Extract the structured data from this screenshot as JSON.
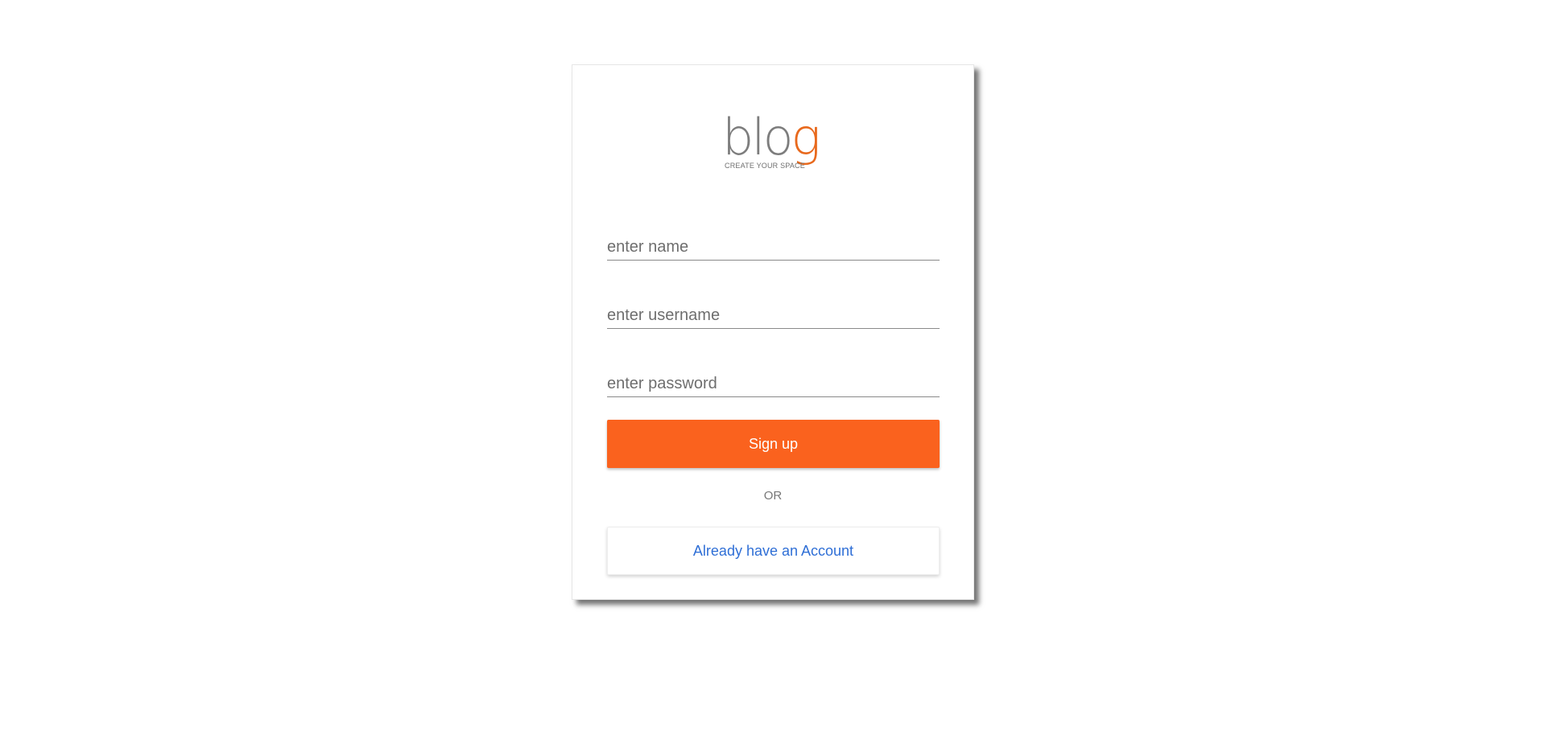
{
  "logo": {
    "word_main": "blo",
    "word_accent": "g",
    "tagline": "CREATE YOUR SPACE"
  },
  "form": {
    "name_placeholder": "enter name",
    "name_value": "",
    "username_placeholder": "enter username",
    "username_value": "",
    "password_placeholder": "enter password",
    "password_value": "",
    "signup_label": "Sign up",
    "divider_text": "OR",
    "login_label": "Already have an Account"
  },
  "colors": {
    "accent": "#fa621e",
    "link": "#2f6fd6",
    "logo_gray": "#7d7d7d",
    "logo_orange": "#e8691d"
  }
}
